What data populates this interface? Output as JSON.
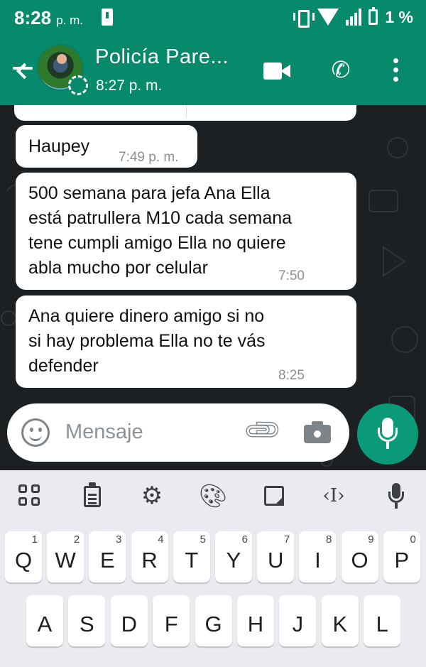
{
  "status_bar": {
    "time": "8:28",
    "time_suffix": "p. m.",
    "battery": "1 %"
  },
  "header": {
    "contact_name": "Policía Pare...",
    "last_seen": "8:27 p. m."
  },
  "messages": [
    {
      "text": "Haupey",
      "time": "7:49 p. m."
    },
    {
      "text": "500 semana para jefa Ana Ella\nestá patrullera M10 cada semana\ntene cumpli amigo Ella no quiere\nabla mucho por celular",
      "time": "7:50"
    },
    {
      "text": "Ana quiere dinero amigo si no\nsi hay problema Ella no te vás\ndefender",
      "time": "8:25"
    }
  ],
  "composer": {
    "placeholder": "Mensaje"
  },
  "keyboard": {
    "row1": [
      {
        "key": "Q",
        "hint": "1"
      },
      {
        "key": "W",
        "hint": "2"
      },
      {
        "key": "E",
        "hint": "3"
      },
      {
        "key": "R",
        "hint": "4"
      },
      {
        "key": "T",
        "hint": "5"
      },
      {
        "key": "Y",
        "hint": "6"
      },
      {
        "key": "U",
        "hint": "7"
      },
      {
        "key": "I",
        "hint": "8"
      },
      {
        "key": "O",
        "hint": "9"
      },
      {
        "key": "P",
        "hint": "0"
      }
    ],
    "row2": [
      "A",
      "S",
      "D",
      "F",
      "G",
      "H",
      "J",
      "K",
      "L"
    ]
  },
  "colors": {
    "header": "#07896b",
    "accent_button": "#0a9a78",
    "chat_background": "#1d2022",
    "bubble": "#ffffff",
    "keyboard": "#e9ebf0"
  }
}
